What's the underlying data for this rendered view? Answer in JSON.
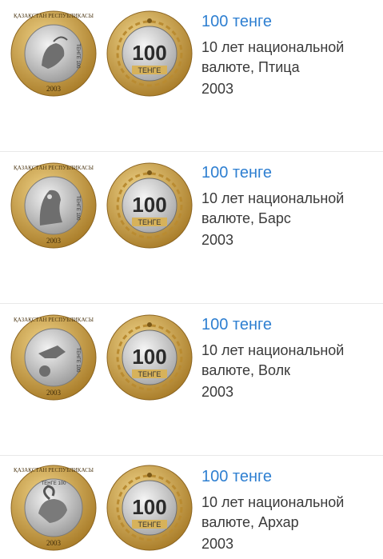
{
  "items": [
    {
      "title": "100 тенге",
      "desc_line1": "10 лет национальной",
      "desc_line2": "валюте, Птица",
      "year": "2003",
      "obverse_icon": "bird-coin-icon",
      "reverse_icon": "100-tenge-coin-icon",
      "obverse_rim_text": "ҚАЗАҚСТАН РЕСПУБЛИКАСЫ",
      "obverse_denomination": "ТЕНГЕ 100",
      "obverse_year": "2003",
      "reverse_value": "100",
      "reverse_currency": "ТЕНГЕ"
    },
    {
      "title": "100 тенге",
      "desc_line1": "10 лет национальной",
      "desc_line2": "валюте, Барс",
      "year": "2003",
      "obverse_icon": "snow-leopard-coin-icon",
      "reverse_icon": "100-tenge-coin-icon",
      "obverse_rim_text": "ҚАЗАҚСТАН РЕСПУБЛИКАСЫ",
      "obverse_denomination": "ТЕНГЕ 100",
      "obverse_year": "2003",
      "reverse_value": "100",
      "reverse_currency": "ТЕНГЕ"
    },
    {
      "title": "100 тенге",
      "desc_line1": "10 лет национальной",
      "desc_line2": "валюте, Волк",
      "year": "2003",
      "obverse_icon": "wolf-coin-icon",
      "reverse_icon": "100-tenge-coin-icon",
      "obverse_rim_text": "ҚАЗАҚСТАН РЕСПУБЛИКАСЫ",
      "obverse_denomination": "ТЕНГЕ 100",
      "obverse_year": "2003",
      "reverse_value": "100",
      "reverse_currency": "ТЕНГЕ"
    },
    {
      "title": "100 тенге",
      "desc_line1": "10 лет национальной",
      "desc_line2": "валюте, Архар",
      "year": "2003",
      "obverse_icon": "argali-coin-icon",
      "reverse_icon": "100-tenge-coin-icon",
      "obverse_rim_text": "ҚАЗАҚСТАН РЕСПУБЛИКАСЫ",
      "obverse_denomination": "ТЕНГЕ 100",
      "obverse_year": "2003",
      "reverse_value": "100",
      "reverse_currency": "ТЕНГЕ"
    }
  ],
  "colors": {
    "title": "#2e7fd1",
    "text": "#3a3a3a",
    "gold_ring": "#d3a84a",
    "silver_center": "#c9c9c9",
    "separator": "#e9e9e9"
  }
}
